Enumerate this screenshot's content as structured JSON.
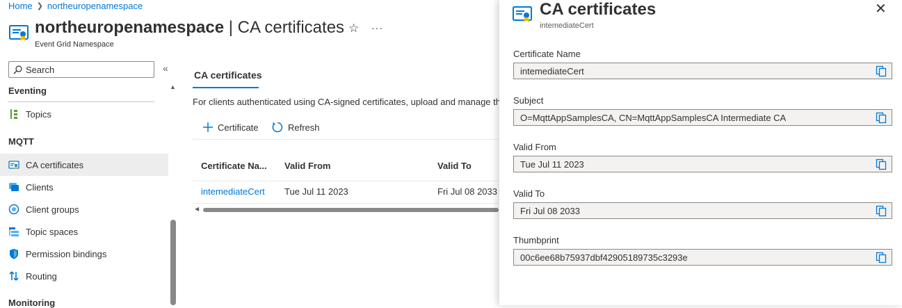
{
  "breadcrumb": {
    "home": "Home",
    "resource": "northeuropenamespace"
  },
  "header": {
    "resource_name": "northeuropenamespace",
    "separator": " | ",
    "page_name": "CA certificates",
    "resource_type": "Event Grid Namespace"
  },
  "sidebar": {
    "search_placeholder": "Search",
    "groups": {
      "eventing": "Eventing",
      "mqtt": "MQTT",
      "monitoring": "Monitoring"
    },
    "items": {
      "topics": "Topics",
      "ca_certificates": "CA certificates",
      "clients": "Clients",
      "client_groups": "Client groups",
      "topic_spaces": "Topic spaces",
      "permission_bindings": "Permission bindings",
      "routing": "Routing"
    }
  },
  "main": {
    "tab": "CA certificates",
    "description": "For clients authenticated using CA-signed certificates, upload and manage th",
    "toolbar": {
      "add": "Certificate",
      "refresh": "Refresh"
    },
    "table": {
      "columns": [
        "Certificate Na...",
        "Valid From",
        "Valid To"
      ],
      "rows": [
        {
          "name": "intemediateCert",
          "valid_from": "Tue Jul 11 2023",
          "valid_to": "Fri Jul 08 2033"
        }
      ]
    }
  },
  "panel": {
    "title": "CA certificates",
    "subtitle": "intemediateCert",
    "fields": [
      {
        "label": "Certificate Name",
        "value": "intemediateCert"
      },
      {
        "label": "Subject",
        "value": "O=MqttAppSamplesCA, CN=MqttAppSamplesCA Intermediate CA"
      },
      {
        "label": "Valid From",
        "value": "Tue Jul 11 2023"
      },
      {
        "label": "Valid To",
        "value": "Fri Jul 08 2033"
      },
      {
        "label": "Thumbprint",
        "value": "00c6ee68b75937dbf42905189735c3293e"
      }
    ]
  },
  "colors": {
    "accent": "#0078d4",
    "nav_active_bg": "#ededed",
    "readonly_field_bg": "#f3f2f1"
  },
  "icons": [
    "certificate-icon",
    "search-icon",
    "collapse-icon",
    "star-icon",
    "more-icon",
    "topics-icon",
    "clients-icon",
    "client-groups-icon",
    "topic-spaces-icon",
    "permission-bindings-icon",
    "routing-icon",
    "add-icon",
    "refresh-icon",
    "copy-icon",
    "close-icon"
  ]
}
